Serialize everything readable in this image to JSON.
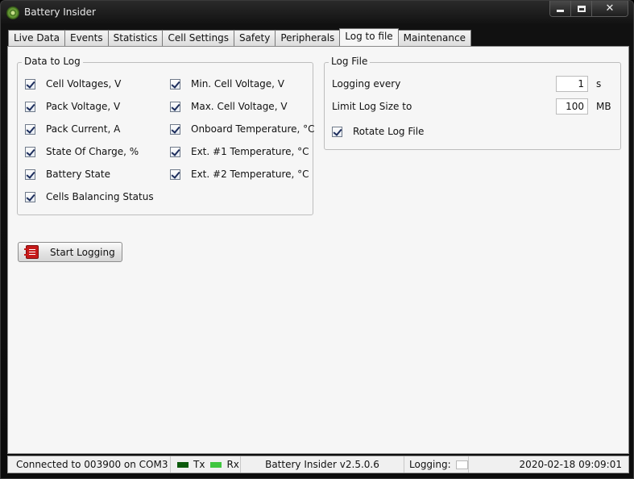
{
  "window": {
    "title": "Battery Insider"
  },
  "tabs": [
    {
      "label": "Live Data"
    },
    {
      "label": "Events"
    },
    {
      "label": "Statistics"
    },
    {
      "label": "Cell Settings"
    },
    {
      "label": "Safety"
    },
    {
      "label": "Peripherals"
    },
    {
      "label": "Log to file",
      "active": true
    },
    {
      "label": "Maintenance"
    }
  ],
  "data_to_log": {
    "legend": "Data to Log",
    "left": [
      {
        "label": "Cell Voltages, V",
        "checked": true
      },
      {
        "label": "Pack Voltage, V",
        "checked": true
      },
      {
        "label": "Pack Current, A",
        "checked": true
      },
      {
        "label": "State Of Charge, %",
        "checked": true
      },
      {
        "label": "Battery State",
        "checked": true
      },
      {
        "label": "Cells Balancing Status",
        "checked": true
      }
    ],
    "right": [
      {
        "label": "Min. Cell Voltage, V",
        "checked": true
      },
      {
        "label": "Max. Cell Voltage, V",
        "checked": true
      },
      {
        "label": "Onboard Temperature, °C",
        "checked": true
      },
      {
        "label": "Ext. #1 Temperature, °C",
        "checked": true
      },
      {
        "label": "Ext. #2 Temperature, °C",
        "checked": true
      }
    ]
  },
  "log_file": {
    "legend": "Log File",
    "logging_every_label": "Logging every",
    "logging_every_value": "1",
    "logging_every_unit": "s",
    "limit_size_label": "Limit Log Size to",
    "limit_size_value": "100",
    "limit_size_unit": "MB",
    "rotate_label": "Rotate Log File",
    "rotate_checked": true
  },
  "start_button": {
    "label": "Start Logging",
    "icon": "log-book-icon"
  },
  "status": {
    "connection": "Connected to 003900 on COM3",
    "tx": "Tx",
    "rx": "Rx",
    "version": "Battery Insider v2.5.0.6",
    "logging_label": "Logging:",
    "datetime": "2020-02-18 09:09:01"
  },
  "colors": {
    "tx_led": "#0c5a0c",
    "rx_led": "#3fc63f",
    "start_icon": "#c71a1a"
  }
}
